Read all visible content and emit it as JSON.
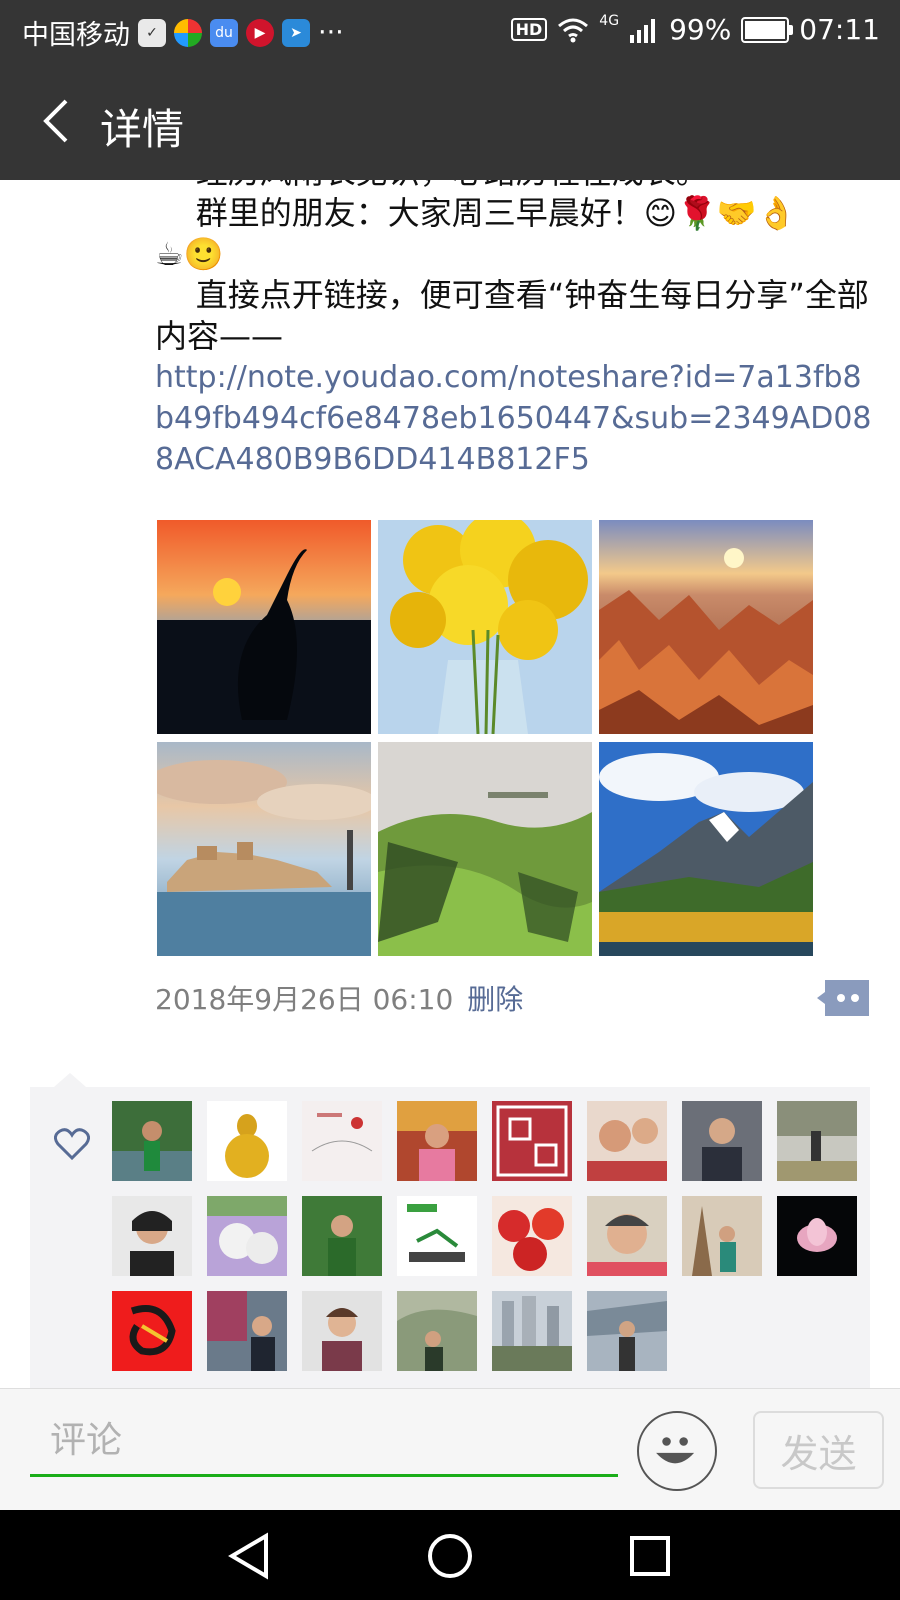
{
  "status_bar": {
    "carrier": "中国移动",
    "more": "···",
    "hd": "HD",
    "network": "4G",
    "battery": "99%",
    "battery_level": 0.99,
    "time": "07:11"
  },
  "title_bar": {
    "title": "详情"
  },
  "post": {
    "line_cut": "    经历风雨长见识，心路历程在成长。",
    "line_greeting": "    群里的朋友：大家周三早晨好！😊🌹🤝👌",
    "line_emoji": "☕🙂",
    "line_instruction": "    直接点开链接，便可查看“钟奋生每日分享”全部内容——",
    "link": "http://note.youdao.com/noteshare?id=7a13fb8b49fb494cf6e8478eb1650447&sub=2349AD088ACA480B9B6DD414B812F5",
    "timestamp": "2018年9月26日 06:10",
    "delete_label": "删除"
  },
  "photos": [
    "crane-sunset",
    "yellow-flowers",
    "canyon-sunrise",
    "coastal-town",
    "green-hills",
    "snow-mountain"
  ],
  "likes": {
    "icon": "heart-icon",
    "avatars": 23
  },
  "comment_bar": {
    "placeholder": "评论",
    "send_label": "发送"
  },
  "colors": {
    "header_bg": "#353535",
    "link": "#576b95",
    "input_underline": "#1aad19",
    "likes_bg": "#f3f3f5"
  }
}
